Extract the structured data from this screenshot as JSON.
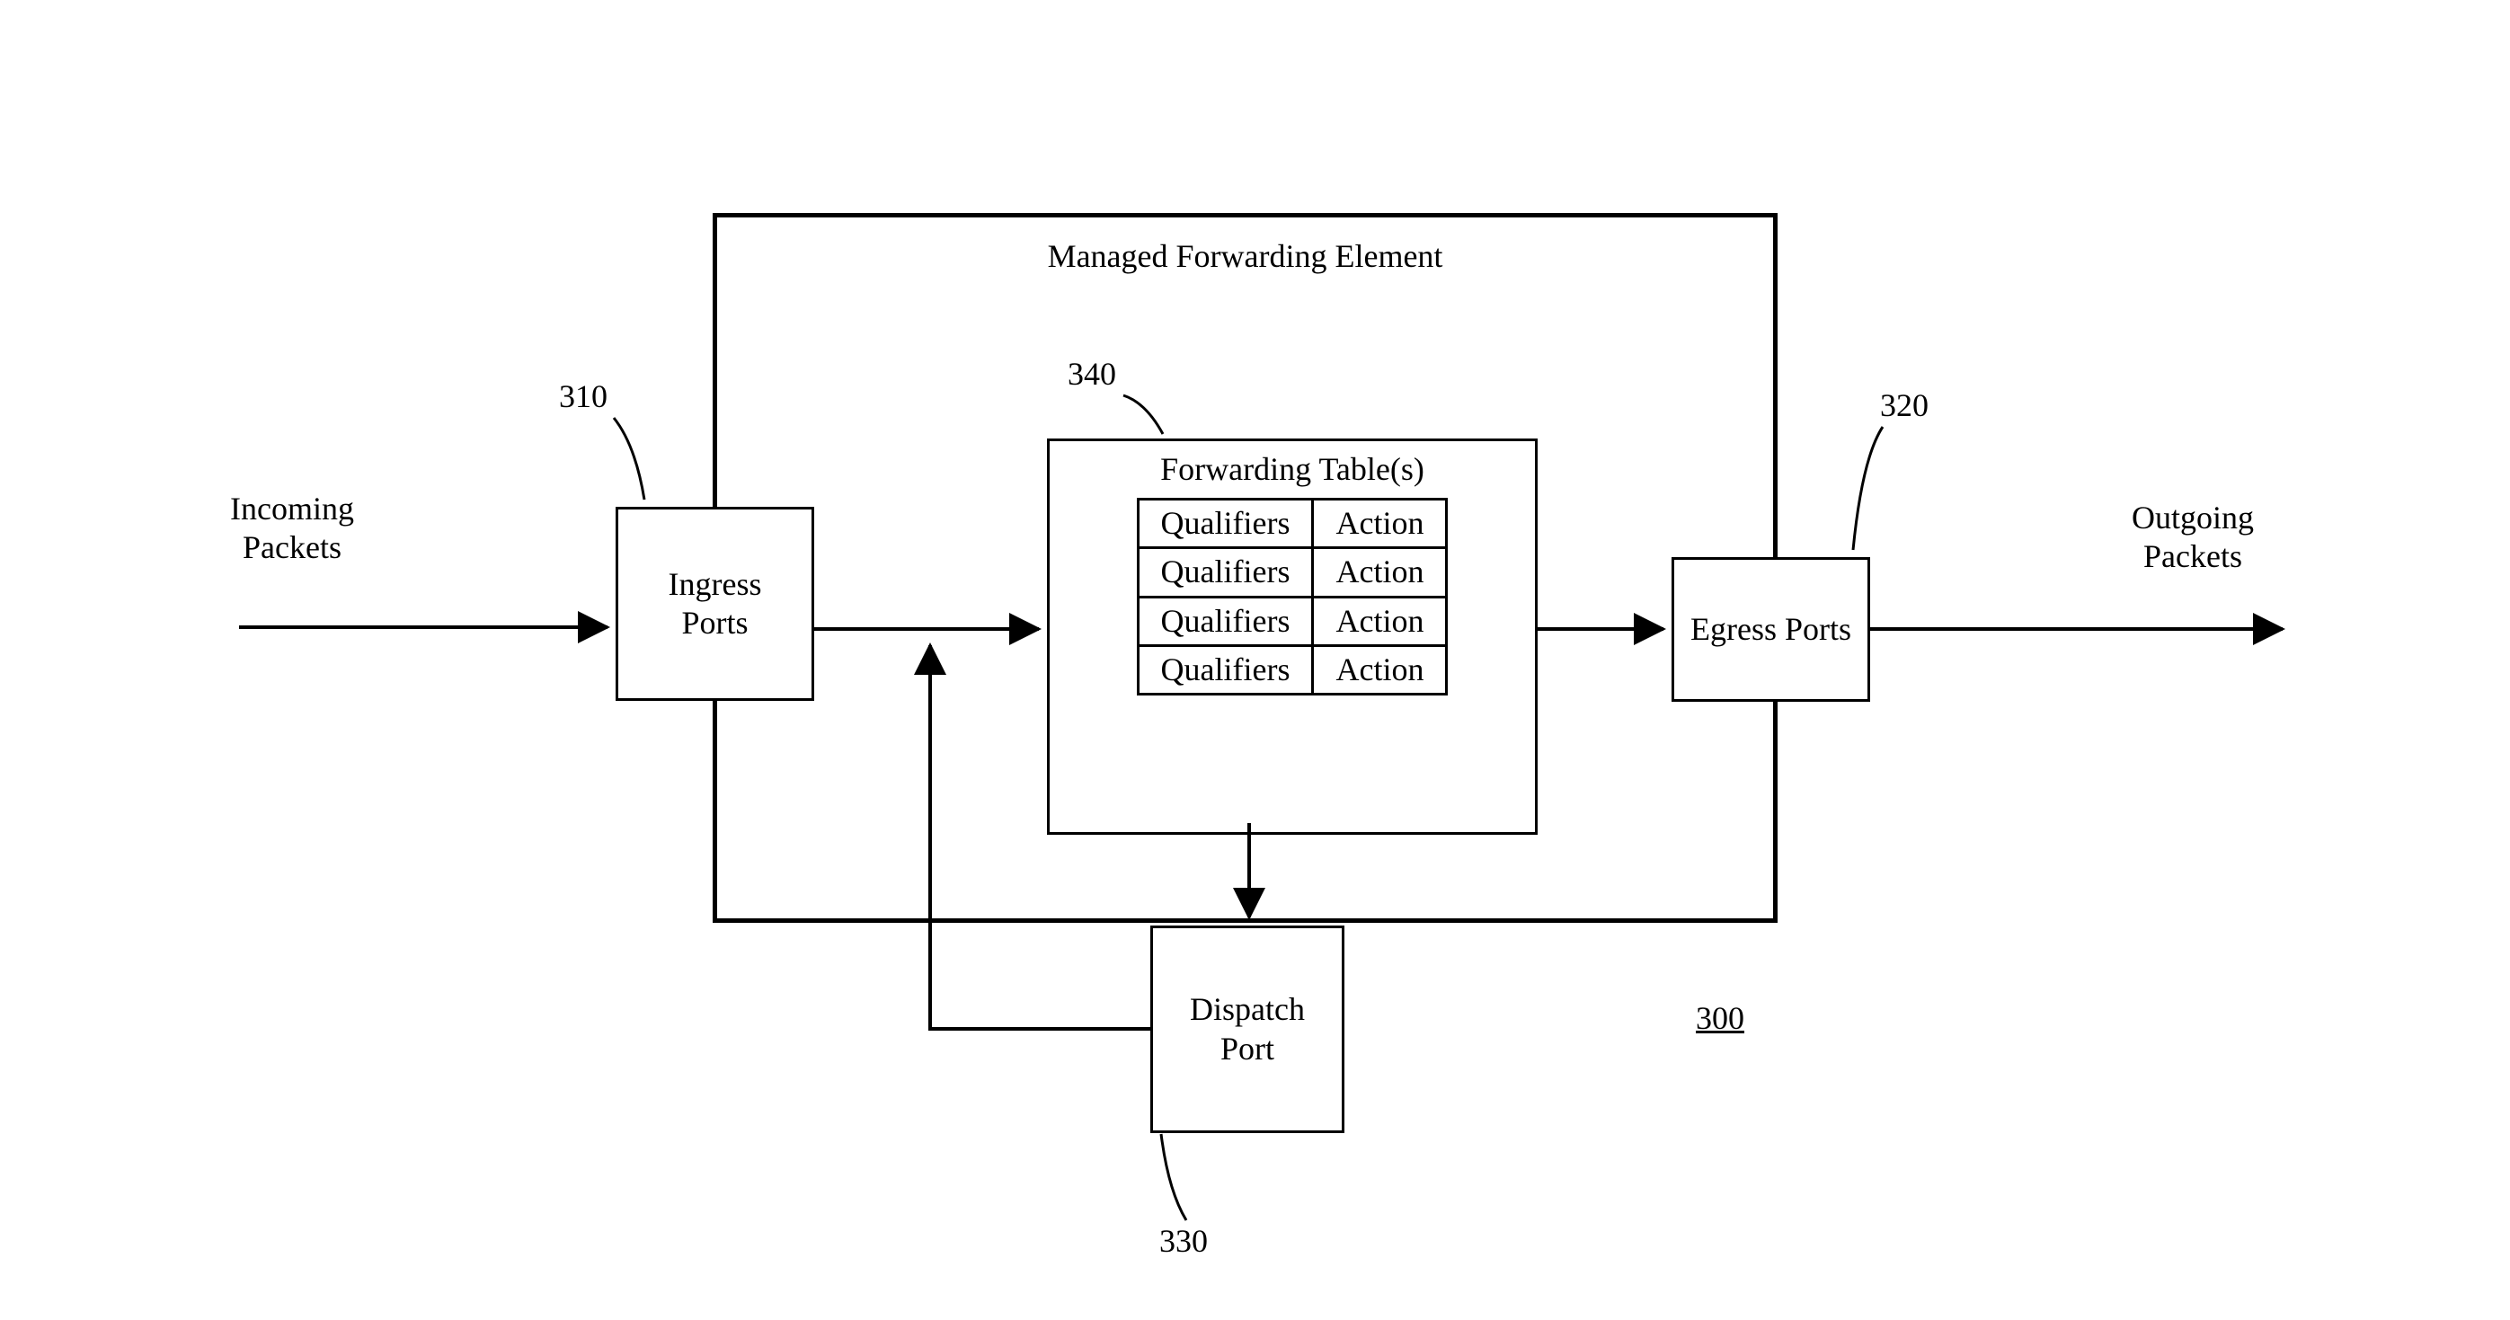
{
  "title": "Managed Forwarding Element",
  "incoming": {
    "line1": "Incoming",
    "line2": "Packets"
  },
  "outgoing": {
    "line1": "Outgoing",
    "line2": "Packets"
  },
  "ingress": {
    "label": "Ingress\nPorts",
    "ref": "310"
  },
  "egress": {
    "label": "Egress Ports",
    "ref": "320"
  },
  "dispatch": {
    "label": "Dispatch\nPort",
    "ref": "330"
  },
  "ft": {
    "ref": "340",
    "title": "Forwarding Table(s)",
    "rows": [
      {
        "q": "Qualifiers",
        "a": "Action"
      },
      {
        "q": "Qualifiers",
        "a": "Action"
      },
      {
        "q": "Qualifiers",
        "a": "Action"
      },
      {
        "q": "Qualifiers",
        "a": "Action"
      }
    ]
  },
  "mfe_ref": "300"
}
